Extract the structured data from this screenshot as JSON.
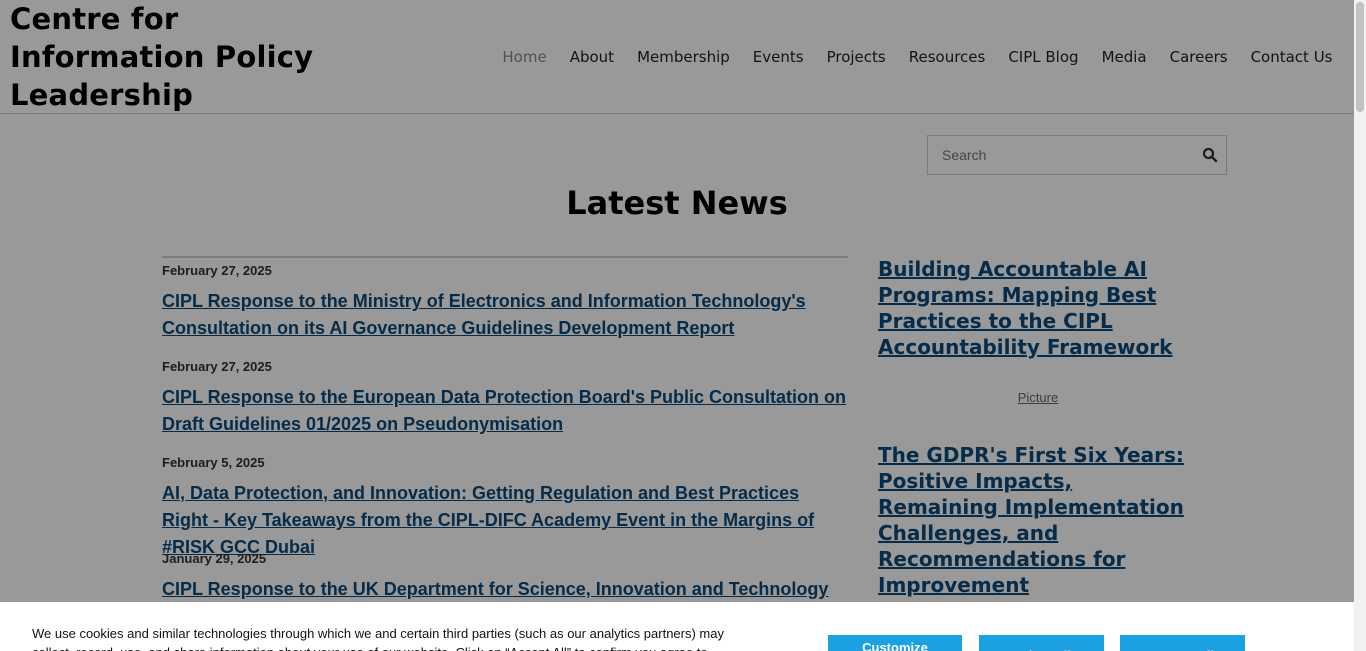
{
  "site": {
    "logo_text": "Centre for Information Policy Leadership"
  },
  "nav": {
    "items": [
      {
        "label": "Home",
        "active": true
      },
      {
        "label": "About"
      },
      {
        "label": "Membership"
      },
      {
        "label": "Events"
      },
      {
        "label": "Projects"
      },
      {
        "label": "Resources"
      },
      {
        "label": "CIPL Blog"
      },
      {
        "label": "Media"
      },
      {
        "label": "Careers"
      },
      {
        "label": "Contact Us"
      }
    ]
  },
  "search": {
    "placeholder": "Search"
  },
  "main": {
    "title": "Latest News",
    "news": [
      {
        "date": "February 27, 2025",
        "title": "CIPL Response to the Ministry of Electronics and Information Technology's Consultation on its AI Governance Guidelines Development Report"
      },
      {
        "date": "February 27, 2025",
        "title": "CIPL Response to the European Data Protection Board's Public Consultation on Draft Guidelines 01/2025 on Pseudonymisation "
      },
      {
        "date": "February 5, 2025",
        "title": "AI, Data Protection, and Innovation: Getting Regulation and Best Practices Right - Key Takeaways from the CIPL-DIFC Academy Event in the Margins of #RISK GCC Dubai"
      },
      {
        "date": "January 29, 2025",
        "title": "CIPL Response to the UK Department for Science, Innovation and Technology (DSIT)'s Consultation on the AI Management Essentials (AIME) Tool"
      }
    ]
  },
  "sidebar": {
    "feature1": "Building Accountable AI Programs: Mapping Best Practices to the CIPL Accountability Framework",
    "picture_label": "Picture",
    "feature2": "The GDPR's First Six Years: Positive Impacts, Remaining Implementation Challenges, and Recommendations for Improvement"
  },
  "cookie": {
    "text": "We use cookies and similar technologies through which we and certain third parties (such as our analytics partners) may collect, record, use, and share information about your use of our website. Click on “Accept All” to confirm you agree to these",
    "customize_label": "Customize Cookies",
    "reject_label": "Reject All",
    "accept_label": "Accept All",
    "button_color": "#1ba1e2"
  }
}
